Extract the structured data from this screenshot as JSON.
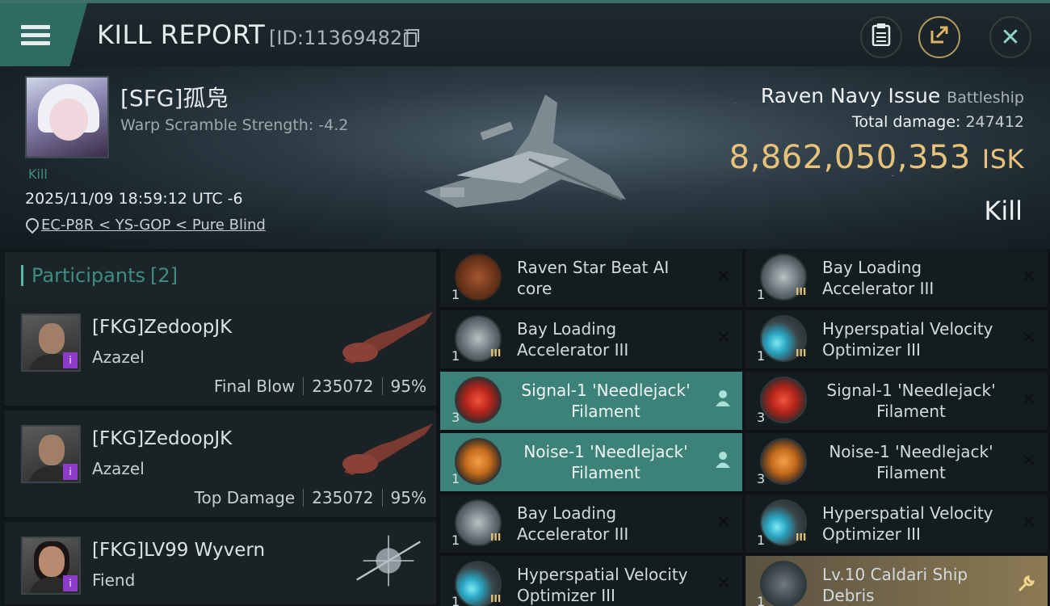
{
  "header": {
    "title": "KILL REPORT",
    "report_id": "[ID:11369482]"
  },
  "victim": {
    "name": "[SFG]孤凫",
    "warp_scramble": "Warp Scramble Strength: -4.2",
    "kill_tag": "Kill",
    "datetime": "2025/11/09 18:59:12 UTC -6",
    "location": "EC-P8R < YS-GOP < Pure Blind",
    "ship_name": "Raven Navy Issue",
    "ship_class": "Battleship",
    "total_damage_label": "Total damage:",
    "total_damage": "247412",
    "isk_value": "8,862,050,353",
    "isk_unit": "ISK",
    "result": "Kill"
  },
  "participants": {
    "label": "Participants",
    "count": "[2]",
    "rows": [
      {
        "name": "[FKG]ZedoopJK",
        "ship": "Azazel",
        "role": "Final Blow",
        "damage": "235072",
        "percent": "95%",
        "badge": "i"
      },
      {
        "name": "[FKG]ZedoopJK",
        "ship": "Azazel",
        "role": "Top Damage",
        "damage": "235072",
        "percent": "95%",
        "badge": "i"
      },
      {
        "name": "[FKG]LV99 Wyvern",
        "ship": "Fiend",
        "badge": "i"
      }
    ]
  },
  "items": [
    {
      "qty": "1",
      "name": "Raven Star Beat AI core",
      "icon": "core-icon",
      "action": "✕",
      "style": "dark"
    },
    {
      "qty": "1",
      "tier": "III",
      "name": "Bay Loading Accelerator III",
      "icon": "bay-icon",
      "action": "✕",
      "style": "dark"
    },
    {
      "qty": "1",
      "tier": "III",
      "name": "Bay Loading Accelerator III",
      "icon": "bay-icon",
      "action": "✕",
      "style": "dark"
    },
    {
      "qty": "1",
      "tier": "III",
      "name": "Hyperspatial Velocity Optimizer III",
      "icon": "hyper-icon",
      "action": "✕",
      "style": "dark"
    },
    {
      "qty": "3",
      "name": "Signal-1 'Needlejack' Filament",
      "icon": "signal-icon",
      "action": "person",
      "style": "teal"
    },
    {
      "qty": "3",
      "name": "Signal-1 'Needlejack' Filament",
      "icon": "signal-icon",
      "action": "✕",
      "style": "dark"
    },
    {
      "qty": "1",
      "name": "Noise-1 'Needlejack' Filament",
      "icon": "noise-icon",
      "action": "person",
      "style": "teal"
    },
    {
      "qty": "3",
      "name": "Noise-1 'Needlejack' Filament",
      "icon": "noise-icon",
      "action": "✕",
      "style": "dark"
    },
    {
      "qty": "1",
      "tier": "III",
      "name": "Bay Loading Accelerator III",
      "icon": "bay-icon",
      "action": "✕",
      "style": "dark"
    },
    {
      "qty": "1",
      "tier": "III",
      "name": "Hyperspatial Velocity Optimizer III",
      "icon": "hyper-icon",
      "action": "✕",
      "style": "dark"
    },
    {
      "qty": "1",
      "tier": "III",
      "name": "Hyperspatial Velocity Optimizer III",
      "icon": "hyper-icon",
      "action": "✕",
      "style": "dark"
    },
    {
      "qty": "1",
      "name": "Lv.10 Caldari Ship Debris",
      "icon": "debris-icon",
      "action": "wrench",
      "style": "gold"
    }
  ],
  "colors": {
    "accent_teal": "#3c8278",
    "isk_gold": "#e8c27a",
    "badge_purple": "#8c3cc9"
  }
}
